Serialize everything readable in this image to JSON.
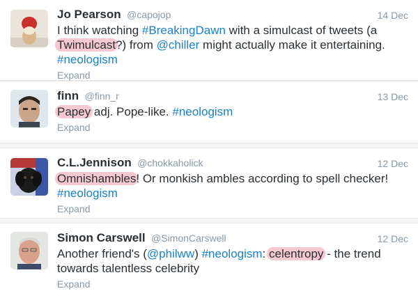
{
  "tweets": [
    {
      "name": "Jo Pearson",
      "handle": "@capojop",
      "date": "14 Dec",
      "text_parts": [
        "I think watching ",
        "#BreakingDawn",
        " with a simulcast of tweets (a ",
        "Twimulcast",
        "?) from ",
        "@chiller",
        " might actually make it entertaining.",
        "#neologism"
      ],
      "expand": "Expand"
    },
    {
      "name": "finn",
      "handle": "@finn_r",
      "date": "13 Dec",
      "text_parts": [
        "Papey",
        " adj. Pope-like. ",
        "#neologism"
      ],
      "expand": "Expand"
    },
    {
      "name": "C.L.Jennison",
      "handle": "@chokkaholick",
      "date": "12 Dec",
      "text_parts": [
        "Omnishambles",
        "! Or monkish ambles according to spell checker!",
        "#neologism"
      ],
      "expand": "Expand"
    },
    {
      "name": "Simon Carswell",
      "handle": "@SimonCarswell",
      "date": "12 Dec",
      "text_parts": [
        "Another friend's (",
        "@philww",
        ") ",
        "#neologism",
        ": ",
        "celentropy",
        " - the trend towards talentless celebrity"
      ],
      "expand": "Expand"
    }
  ],
  "colors": {
    "link": "#1a82c4",
    "highlight": "#f6c9d2",
    "meta": "#8899a6",
    "text": "#292f33"
  }
}
